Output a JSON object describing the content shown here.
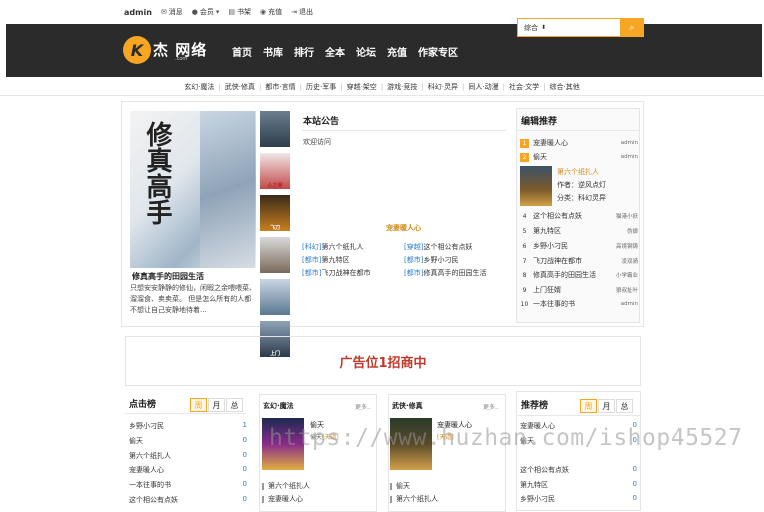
{
  "topbar": {
    "user": "admin",
    "items": [
      "消息",
      "会员",
      "书架",
      "充值",
      "退出"
    ]
  },
  "logo": {
    "text": "杰  网络",
    "domain": ".com"
  },
  "nav": [
    "首页",
    "书库",
    "排行",
    "全本",
    "论坛",
    "充值",
    "作家专区"
  ],
  "search": {
    "select_value": "综合"
  },
  "categories": [
    "玄幻·魔法",
    "武侠·修真",
    "都市·言情",
    "历史·军事",
    "穿越·架空",
    "游戏·竞技",
    "科幻·灵异",
    "同人·动漫",
    "社会·文学",
    "综合·其他"
  ],
  "feature_book": {
    "title": "修真高手的田园生活",
    "cover_title": "修真高手",
    "desc": "只想安安静静的修仙，闲暇之余喂喂菜、溜溜食、卖卖菜。 但是怎么所有的人都不想让自己安静地待着..."
  },
  "thumbs": [
    "",
    "心之网",
    "飞刀",
    "",
    "",
    "上门"
  ],
  "notice": {
    "title": "本站公告",
    "welcome": "欢迎访问",
    "ad_label": "宠妻暖人心",
    "links": [
      {
        "tag": "[科幻]",
        "name": "第六个纸扎人"
      },
      {
        "tag": "[穿越]",
        "name": "这个相公有点妖"
      },
      {
        "tag": "[都市]",
        "name": "第九特区"
      },
      {
        "tag": "[都市]",
        "name": "乡野小刁民"
      },
      {
        "tag": "[都市]",
        "name": "飞刀战神在都市"
      },
      {
        "tag": "[都市]",
        "name": "修真高手的田园生活"
      }
    ]
  },
  "editor": {
    "title": "编辑推荐",
    "items": [
      {
        "n": "1",
        "name": "宠妻暖人心",
        "author": "admin"
      },
      {
        "n": "2",
        "name": "偷天",
        "author": "admin"
      },
      {
        "n": "4",
        "name": "这个相公有点妖",
        "author": "猫港小妖"
      },
      {
        "n": "5",
        "name": "第九特区",
        "author": "伪娘"
      },
      {
        "n": "6",
        "name": "乡野小刁民",
        "author": "高境钢铸"
      },
      {
        "n": "7",
        "name": "飞刀战神在都市",
        "author": "凌双骑"
      },
      {
        "n": "8",
        "name": "修真高手的田园生活",
        "author": "小学霸业"
      },
      {
        "n": "9",
        "name": "上门狂婿",
        "author": "狼叔扯叶"
      },
      {
        "n": "10",
        "name": "一本往事的书",
        "author": "admin"
      }
    ],
    "featured": {
      "n": "3",
      "name": "第六个纸扎人",
      "author": "作者：逆风点灯",
      "category": "分类：科幻灵异"
    }
  },
  "ad_banner": "广告位1招商中",
  "click_rank": {
    "title": "点击榜",
    "tabs": [
      "周",
      "月",
      "总"
    ],
    "rows": [
      {
        "name": "乡野小刁民",
        "v": "1"
      },
      {
        "name": "偷天",
        "v": "0"
      },
      {
        "name": "第六个纸扎人",
        "v": "0"
      },
      {
        "name": "宠妻暖人心",
        "v": "0"
      },
      {
        "name": "一本往事的书",
        "v": "0"
      },
      {
        "name": "这个相公有点妖",
        "v": "0"
      }
    ]
  },
  "genre1": {
    "title": "玄幻·魔法",
    "more": "更多..",
    "book": "偷天",
    "author": "偷天",
    "tag": "[天道]",
    "list": [
      "第六个纸扎人",
      "宠妻暖人心"
    ]
  },
  "genre2": {
    "title": "武侠·修真",
    "more": "更多..",
    "book": "宠妻暖人心",
    "tag": "[天道]",
    "list": [
      "偷天",
      "第六个纸扎人"
    ]
  },
  "recommend_rank": {
    "title": "推荐榜",
    "tabs": [
      "周",
      "月",
      "总"
    ],
    "rows": [
      {
        "name": "宠妻暖人心",
        "v": "0"
      },
      {
        "name": "偷天",
        "v": "0"
      },
      {
        "name": "这个相公有点妖",
        "v": "0"
      },
      {
        "name": "第九特区",
        "v": "0"
      },
      {
        "name": "乡野小刁民",
        "v": "0"
      }
    ]
  },
  "watermark": "https://www.huzhan.com/ishop45527",
  "colors": {
    "accent": "#f6a623",
    "header_bg": "#2b2b2b",
    "link": "#2b7ccf",
    "ad_text": "#c0392b"
  }
}
